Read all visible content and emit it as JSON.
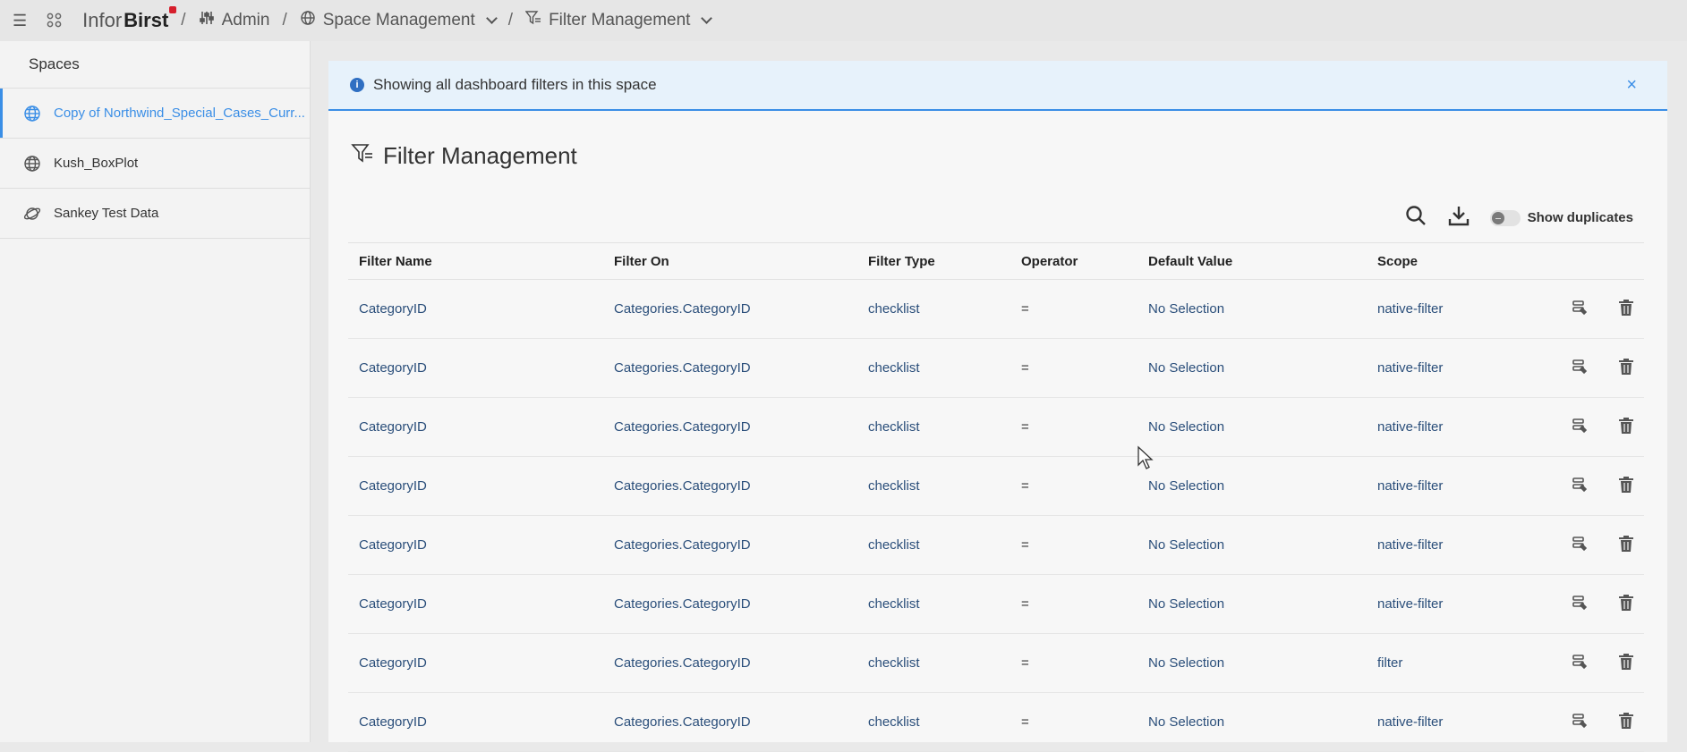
{
  "topbar": {
    "brand_infor": "Infor",
    "brand_birst": "Birst",
    "crumbs": [
      "Admin",
      "Space Management",
      "Filter Management"
    ],
    "menu_icon": "hamburger-icon",
    "apps_icon": "apps-grid-icon"
  },
  "sidebar": {
    "header": "Spaces",
    "items": [
      {
        "label": "Copy of Northwind_Special_Cases_Curr...",
        "icon": "globe-icon",
        "active": true
      },
      {
        "label": "Kush_BoxPlot",
        "icon": "globe-icon",
        "active": false
      },
      {
        "label": "Sankey Test Data",
        "icon": "planet-icon",
        "active": false
      }
    ]
  },
  "banner": {
    "text": "Showing all dashboard filters in this space",
    "close": "×"
  },
  "page": {
    "title": "Filter Management",
    "show_duplicates_label": "Show duplicates",
    "show_duplicates_on": false
  },
  "table": {
    "columns": [
      "Filter Name",
      "Filter On",
      "Filter Type",
      "Operator",
      "Default Value",
      "Scope"
    ],
    "rows": [
      [
        "CategoryID",
        "Categories.CategoryID",
        "checklist",
        "=",
        "No Selection",
        "native-filter"
      ],
      [
        "CategoryID",
        "Categories.CategoryID",
        "checklist",
        "=",
        "No Selection",
        "native-filter"
      ],
      [
        "CategoryID",
        "Categories.CategoryID",
        "checklist",
        "=",
        "No Selection",
        "native-filter"
      ],
      [
        "CategoryID",
        "Categories.CategoryID",
        "checklist",
        "=",
        "No Selection",
        "native-filter"
      ],
      [
        "CategoryID",
        "Categories.CategoryID",
        "checklist",
        "=",
        "No Selection",
        "native-filter"
      ],
      [
        "CategoryID",
        "Categories.CategoryID",
        "checklist",
        "=",
        "No Selection",
        "native-filter"
      ],
      [
        "CategoryID",
        "Categories.CategoryID",
        "checklist",
        "=",
        "No Selection",
        "filter"
      ],
      [
        "CategoryID",
        "Categories.CategoryID",
        "checklist",
        "=",
        "No Selection",
        "native-filter"
      ]
    ],
    "row_actions": [
      "edit-filter-icon",
      "delete-icon"
    ]
  },
  "colors": {
    "accent": "#3a8ee6",
    "banner_bg": "#e7f2fb",
    "brand_dot": "#d61f2c"
  }
}
